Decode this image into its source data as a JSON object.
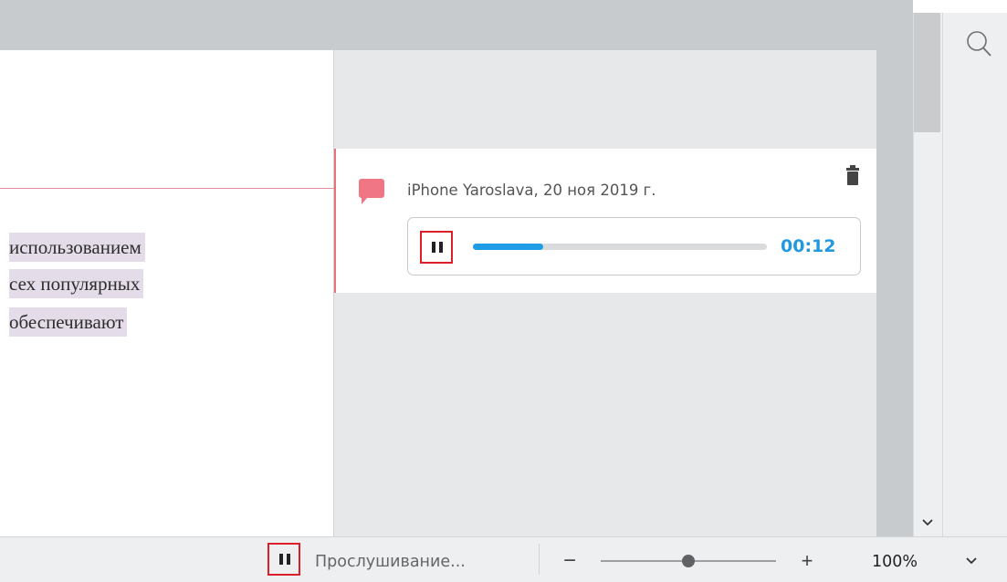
{
  "document": {
    "highlighted_lines": [
      "использованием",
      "сех популярных",
      " обеспечивают"
    ]
  },
  "comment": {
    "author_date": "iPhone Yaroslava, 20 ноя 2019 г.",
    "audio": {
      "time": "00:12",
      "progress": 0.24
    }
  },
  "status_bar": {
    "status_label": "Прослушивание...",
    "zoom_minus": "−",
    "zoom_plus": "+",
    "zoom_value": "100%",
    "zoom_level": 0.5
  },
  "icons": {
    "search": "search-icon",
    "comment": "comment-bubble-icon",
    "trash": "trash-icon",
    "pause": "pause-icon",
    "scroll_down": "chevron-down-icon",
    "dropdown": "chevron-down-icon"
  },
  "colors": {
    "accent": "#2298e0",
    "highlight": "#e4dde9",
    "comment_marker": "#f07585",
    "focus_outline": "#dd1f2a"
  }
}
